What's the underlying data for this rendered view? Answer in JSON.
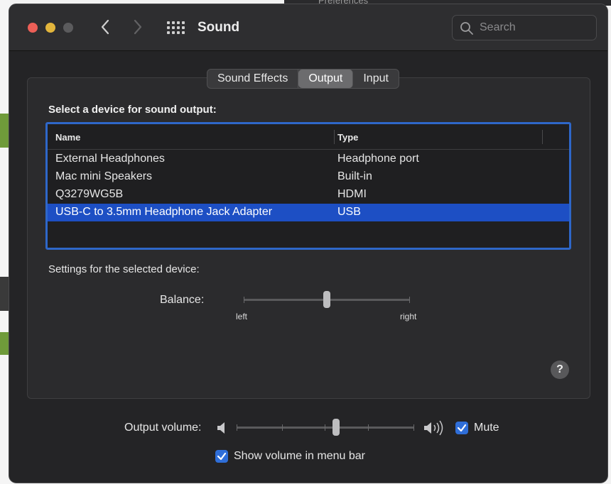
{
  "background": {
    "peek_text": "Preferences"
  },
  "window": {
    "title": "Sound",
    "search_placeholder": "Search"
  },
  "tabs": [
    {
      "label": "Sound Effects",
      "selected": false
    },
    {
      "label": "Output",
      "selected": true
    },
    {
      "label": "Input",
      "selected": false
    }
  ],
  "output": {
    "select_label": "Select a device for sound output:",
    "columns": {
      "name": "Name",
      "type": "Type"
    },
    "devices": [
      {
        "name": "External Headphones",
        "type": "Headphone port",
        "selected": false
      },
      {
        "name": "Mac mini Speakers",
        "type": "Built-in",
        "selected": false
      },
      {
        "name": "Q3279WG5B",
        "type": "HDMI",
        "selected": false
      },
      {
        "name": "USB-C to 3.5mm Headphone Jack Adapter",
        "type": "USB",
        "selected": true
      }
    ],
    "settings_label": "Settings for the selected device:",
    "balance": {
      "label": "Balance:",
      "left_label": "left",
      "right_label": "right",
      "value": 0.5
    }
  },
  "footer": {
    "volume_label": "Output volume:",
    "volume_value": 0.56,
    "mute_label": "Mute",
    "mute_checked": true,
    "menu_bar_label": "Show volume in menu bar",
    "menu_bar_checked": true
  },
  "colors": {
    "selection": "#1d4fc4",
    "focus_ring": "#2e67c9",
    "checkbox": "#2f6ed8",
    "close": "#ec5f57",
    "minimize": "#e2b53c"
  },
  "icons": [
    "close-button",
    "minimize-button",
    "zoom-button",
    "chevron-left-icon",
    "chevron-right-icon",
    "grid-icon",
    "search-icon",
    "question-mark-icon",
    "speaker-low-icon",
    "speaker-high-icon",
    "checkmark-icon"
  ]
}
